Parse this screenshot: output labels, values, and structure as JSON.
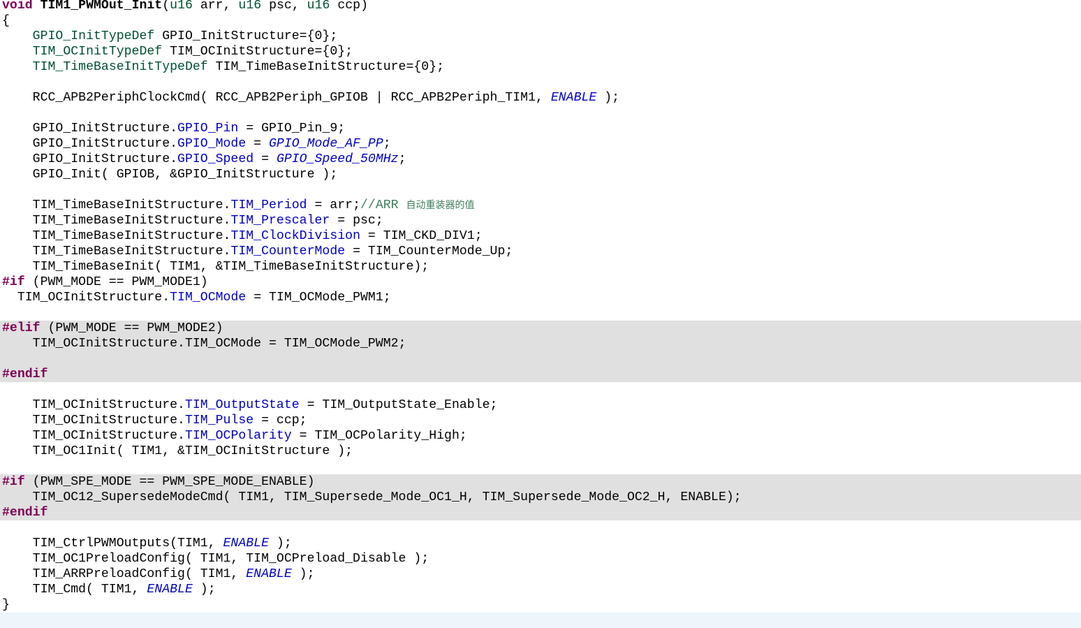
{
  "editor": {
    "colors": {
      "keyword": "#7f0055",
      "type": "#005032",
      "field": "#0000c0",
      "macro": "#0000c0",
      "comment": "#3f7f5f",
      "inactive_bg": "#e0e0e0",
      "current_line_bg": "#eef5fb"
    },
    "lines": [
      {
        "tokens": [
          [
            "void",
            "keyword"
          ],
          [
            " ",
            "normal"
          ],
          [
            "TIM1_PWMOut_Init",
            "funcname"
          ],
          [
            "(",
            "normal"
          ],
          [
            "u16",
            "type"
          ],
          [
            " arr, ",
            "normal"
          ],
          [
            "u16",
            "type"
          ],
          [
            " psc, ",
            "normal"
          ],
          [
            "u16",
            "type"
          ],
          [
            " ccp)",
            "normal"
          ]
        ]
      },
      {
        "tokens": [
          [
            "{",
            "normal"
          ]
        ]
      },
      {
        "tokens": [
          [
            "    ",
            "normal"
          ],
          [
            "GPIO_InitTypeDef",
            "type"
          ],
          [
            " GPIO_InitStructure={0};",
            "normal"
          ]
        ]
      },
      {
        "tokens": [
          [
            "    ",
            "normal"
          ],
          [
            "TIM_OCInitTypeDef",
            "type"
          ],
          [
            " TIM_OCInitStructure={0};",
            "normal"
          ]
        ]
      },
      {
        "tokens": [
          [
            "    ",
            "normal"
          ],
          [
            "TIM_TimeBaseInitTypeDef",
            "type"
          ],
          [
            " TIM_TimeBaseInitStructure={0};",
            "normal"
          ]
        ]
      },
      {
        "tokens": []
      },
      {
        "tokens": [
          [
            "    RCC_APB2PeriphClockCmd( RCC_APB2Periph_GPIOB | RCC_APB2Periph_TIM1, ",
            "normal"
          ],
          [
            "ENABLE",
            "macro"
          ],
          [
            " );",
            "normal"
          ]
        ]
      },
      {
        "tokens": []
      },
      {
        "tokens": [
          [
            "    GPIO_InitStructure.",
            "normal"
          ],
          [
            "GPIO_Pin",
            "field"
          ],
          [
            " = GPIO_Pin_9;",
            "normal"
          ]
        ]
      },
      {
        "tokens": [
          [
            "    GPIO_InitStructure.",
            "normal"
          ],
          [
            "GPIO_Mode",
            "field"
          ],
          [
            " = ",
            "normal"
          ],
          [
            "GPIO_Mode_AF_PP",
            "macro"
          ],
          [
            ";",
            "normal"
          ]
        ]
      },
      {
        "tokens": [
          [
            "    GPIO_InitStructure.",
            "normal"
          ],
          [
            "GPIO_Speed",
            "field"
          ],
          [
            " = ",
            "normal"
          ],
          [
            "GPIO_Speed_50MHz",
            "macro"
          ],
          [
            ";",
            "normal"
          ]
        ]
      },
      {
        "tokens": [
          [
            "    GPIO_Init( GPIOB, &GPIO_InitStructure );",
            "normal"
          ]
        ]
      },
      {
        "tokens": []
      },
      {
        "tokens": [
          [
            "    TIM_TimeBaseInitStructure.",
            "normal"
          ],
          [
            "TIM_Period",
            "field"
          ],
          [
            " = arr;",
            "normal"
          ],
          [
            "//ARR ",
            "comment"
          ],
          [
            "自动重装器的值",
            "cjk"
          ]
        ]
      },
      {
        "tokens": [
          [
            "    TIM_TimeBaseInitStructure.",
            "normal"
          ],
          [
            "TIM_Prescaler",
            "field"
          ],
          [
            " = psc;",
            "normal"
          ]
        ]
      },
      {
        "tokens": [
          [
            "    TIM_TimeBaseInitStructure.",
            "normal"
          ],
          [
            "TIM_ClockDivision",
            "field"
          ],
          [
            " = TIM_CKD_DIV1;",
            "normal"
          ]
        ]
      },
      {
        "tokens": [
          [
            "    TIM_TimeBaseInitStructure.",
            "normal"
          ],
          [
            "TIM_CounterMode",
            "field"
          ],
          [
            " = TIM_CounterMode_Up;",
            "normal"
          ]
        ]
      },
      {
        "tokens": [
          [
            "    TIM_TimeBaseInit( TIM1, &TIM_TimeBaseInitStructure);",
            "normal"
          ]
        ]
      },
      {
        "tokens": [
          [
            "#if",
            "directive"
          ],
          [
            " (PWM_MODE == PWM_MODE1)",
            "normal"
          ]
        ]
      },
      {
        "tokens": [
          [
            "  TIM_OCInitStructure.",
            "normal"
          ],
          [
            "TIM_OCMode",
            "field"
          ],
          [
            " = TIM_OCMode_PWM1;",
            "normal"
          ]
        ]
      },
      {
        "tokens": []
      },
      {
        "tokens": [
          [
            "#elif",
            "directive"
          ],
          [
            " (PWM_MODE == PWM_MODE2)",
            "normal"
          ]
        ],
        "inactive": true
      },
      {
        "tokens": [
          [
            "    TIM_OCInitStructure.TIM_OCMode = TIM_OCMode_PWM2;",
            "normal"
          ]
        ],
        "inactive": true
      },
      {
        "tokens": [],
        "inactive": true
      },
      {
        "tokens": [
          [
            "#endif",
            "directive"
          ]
        ],
        "inactive": true
      },
      {
        "tokens": []
      },
      {
        "tokens": [
          [
            "    TIM_OCInitStructure.",
            "normal"
          ],
          [
            "TIM_OutputState",
            "field"
          ],
          [
            " = TIM_OutputState_Enable;",
            "normal"
          ]
        ]
      },
      {
        "tokens": [
          [
            "    TIM_OCInitStructure.",
            "normal"
          ],
          [
            "TIM_Pulse",
            "field"
          ],
          [
            " = ccp;",
            "normal"
          ]
        ]
      },
      {
        "tokens": [
          [
            "    TIM_OCInitStructure.",
            "normal"
          ],
          [
            "TIM_OCPolarity",
            "field"
          ],
          [
            " = TIM_OCPolarity_High;",
            "normal"
          ]
        ]
      },
      {
        "tokens": [
          [
            "    TIM_OC1Init( TIM1, &TIM_OCInitStructure );",
            "normal"
          ]
        ]
      },
      {
        "tokens": []
      },
      {
        "tokens": [
          [
            "#if",
            "directive"
          ],
          [
            " (PWM_SPE_MODE == PWM_SPE_MODE_ENABLE)",
            "normal"
          ]
        ],
        "inactive": true
      },
      {
        "tokens": [
          [
            "    TIM_OC12_SupersedeModeCmd( TIM1, TIM_Supersede_Mode_OC1_H, TIM_Supersede_Mode_OC2_H, ENABLE);",
            "normal"
          ]
        ],
        "inactive": true
      },
      {
        "tokens": [
          [
            "#endif",
            "directive"
          ]
        ],
        "inactive": true
      },
      {
        "tokens": []
      },
      {
        "tokens": [
          [
            "    TIM_CtrlPWMOutputs(TIM1, ",
            "normal"
          ],
          [
            "ENABLE",
            "macro"
          ],
          [
            " );",
            "normal"
          ]
        ]
      },
      {
        "tokens": [
          [
            "    TIM_OC1PreloadConfig( TIM1, TIM_OCPreload_Disable );",
            "normal"
          ]
        ]
      },
      {
        "tokens": [
          [
            "    TIM_ARRPreloadConfig( TIM1, ",
            "normal"
          ],
          [
            "ENABLE",
            "macro"
          ],
          [
            " );",
            "normal"
          ]
        ]
      },
      {
        "tokens": [
          [
            "    TIM_Cmd( TIM1, ",
            "normal"
          ],
          [
            "ENABLE",
            "macro"
          ],
          [
            " );",
            "normal"
          ]
        ]
      },
      {
        "tokens": [
          [
            "}",
            "normal"
          ]
        ]
      },
      {
        "tokens": [],
        "current": true
      }
    ]
  }
}
